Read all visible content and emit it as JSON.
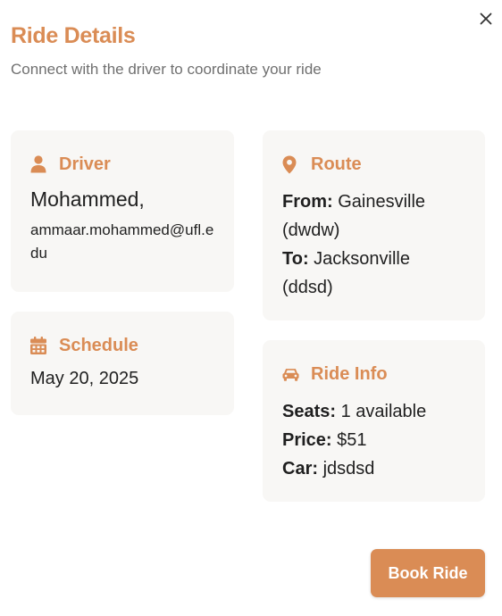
{
  "dialog": {
    "title": "Ride Details",
    "subtitle": "Connect with the driver to coordinate your ride",
    "close_icon": "close-icon"
  },
  "driver": {
    "heading": "Driver",
    "icon": "user-icon",
    "name": "Mohammed,",
    "email": "ammaar.mohammed@ufl.edu"
  },
  "schedule": {
    "heading": "Schedule",
    "icon": "calendar-icon",
    "date": "May 20, 2025"
  },
  "route": {
    "heading": "Route",
    "icon": "map-pin-icon",
    "from_label": "From:",
    "from_value": "Gainesville (dwdw)",
    "to_label": "To:",
    "to_value": "Jacksonville (ddsd)"
  },
  "ride_info": {
    "heading": "Ride Info",
    "icon": "car-icon",
    "seats_label": "Seats:",
    "seats_value": "1 available",
    "price_label": "Price:",
    "price_value": "$51",
    "car_label": "Car:",
    "car_value": "jdsdsd"
  },
  "actions": {
    "book_label": "Book Ride"
  },
  "colors": {
    "accent": "#da8c55",
    "card_bg": "#f8f7f5",
    "subtitle": "#707070"
  }
}
